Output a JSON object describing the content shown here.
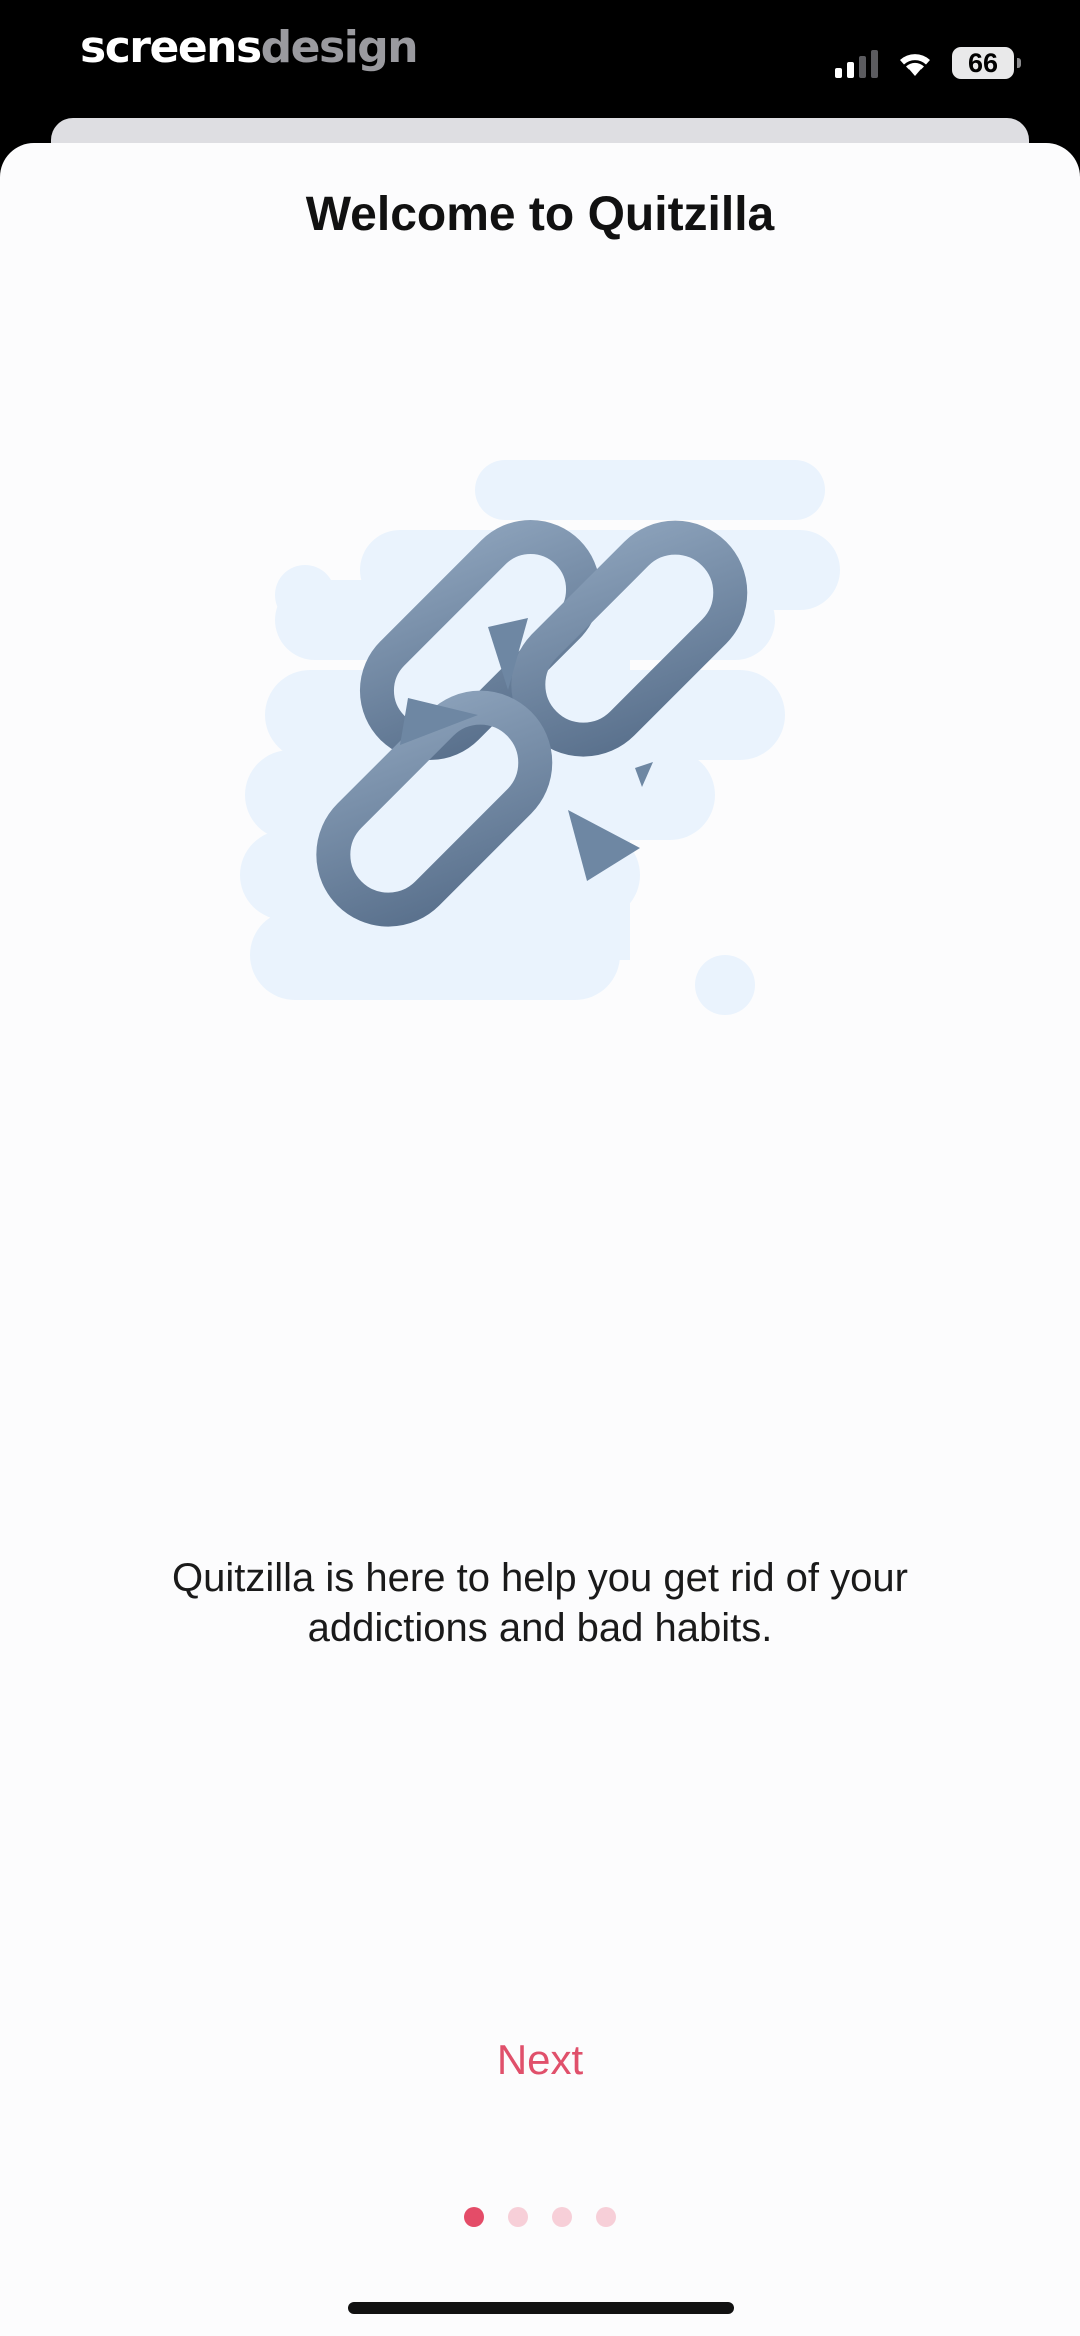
{
  "status_bar": {
    "watermark_part1": "screens",
    "watermark_part2": "design",
    "battery_level": "66",
    "signal_strength_bars": 2,
    "icons": [
      "cellular-signal-icon",
      "wifi-icon",
      "battery-icon"
    ]
  },
  "onboarding": {
    "title": "Welcome to Quitzilla",
    "illustration_icon": "broken-chain-icon",
    "description": "Quitzilla is here to help you get rid of your addictions and bad habits.",
    "next_label": "Next",
    "page_count": 4,
    "current_page": 1
  },
  "colors": {
    "accent": "#e0506b",
    "dot_active": "#e44c68",
    "dot_inactive": "#f7cfd8",
    "chain": "#6e87a3",
    "blob": "#eaf3fd",
    "sheet_background": "#fcfcfd"
  }
}
